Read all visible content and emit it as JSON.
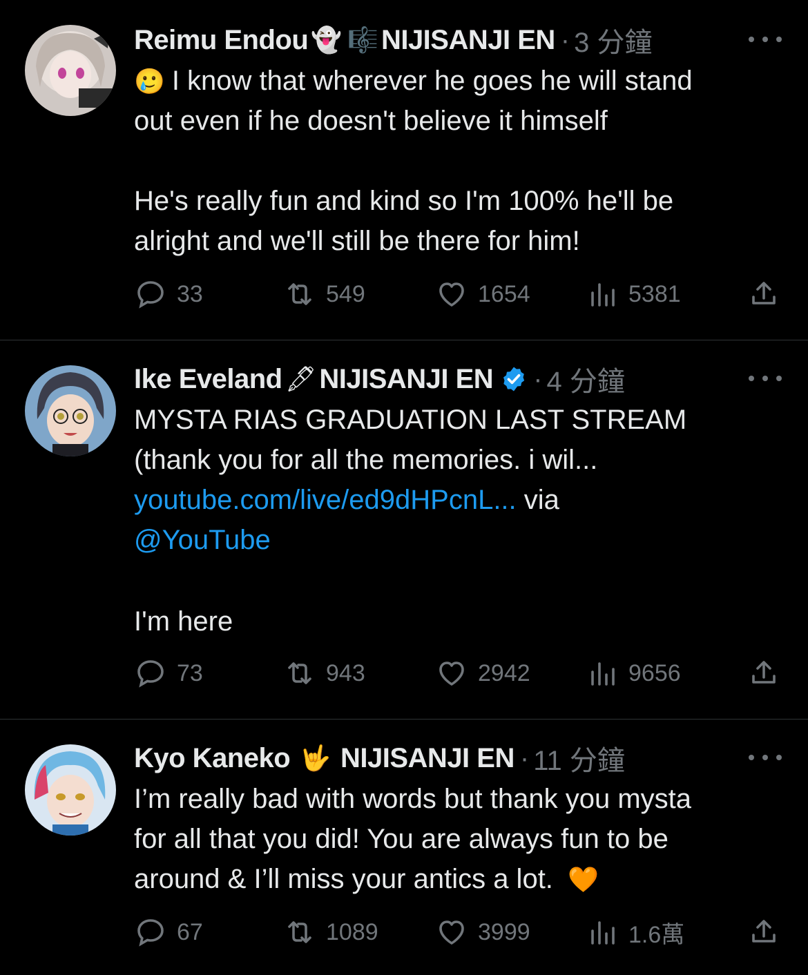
{
  "tweets": [
    {
      "author": "Reimu Endou",
      "emoji_after_name": "👻",
      "emoji2": "🎼",
      "affiliation": "NIJISANJI EN",
      "time": "3 分鐘",
      "text_lines": [
        "I know that wherever he goes he will stand",
        "out even if he doesn't believe it himself",
        "",
        "He's really fun and kind so I'm 100% he'll be",
        "alright and we'll still be there for him!"
      ],
      "leading_emoji": "🥲",
      "replies": "33",
      "retweets": "549",
      "likes": "1654",
      "views": "5381"
    },
    {
      "author": "Ike Eveland",
      "emoji_after_name": "🖋",
      "affiliation": "NIJISANJI EN",
      "time": "4 分鐘",
      "text_lines": [
        "MYSTA RIAS GRADUATION LAST STREAM",
        "(thank you for all the memories. i wil..."
      ],
      "link": "youtube.com/live/ed9dHPcnL...",
      "via": " via",
      "mention": "@YouTube",
      "last_line": "I'm here",
      "replies": "73",
      "retweets": "943",
      "likes": "2942",
      "views": "9656"
    },
    {
      "author": "Kyo Kaneko",
      "emoji_after_name": "🤟",
      "affiliation": "NIJISANJI EN",
      "time": "11 分鐘",
      "text_lines": [
        "I’m really bad with words but thank you mysta",
        "for all that you did! You are always fun to be",
        "around & I’ll miss your antics a lot."
      ],
      "trailing_emoji": "🧡",
      "replies": "67",
      "retweets": "1089",
      "likes": "3999",
      "views": "1.6萬"
    }
  ],
  "separator": "·",
  "icons": [
    "reply-icon",
    "retweet-icon",
    "like-icon",
    "views-icon",
    "share-icon",
    "more-icon",
    "verified-badge-icon"
  ],
  "colors": {
    "background": "#000000",
    "text": "#e7e9ea",
    "muted": "#71767b",
    "link": "#1d9bf0",
    "divider": "#2f3336"
  }
}
